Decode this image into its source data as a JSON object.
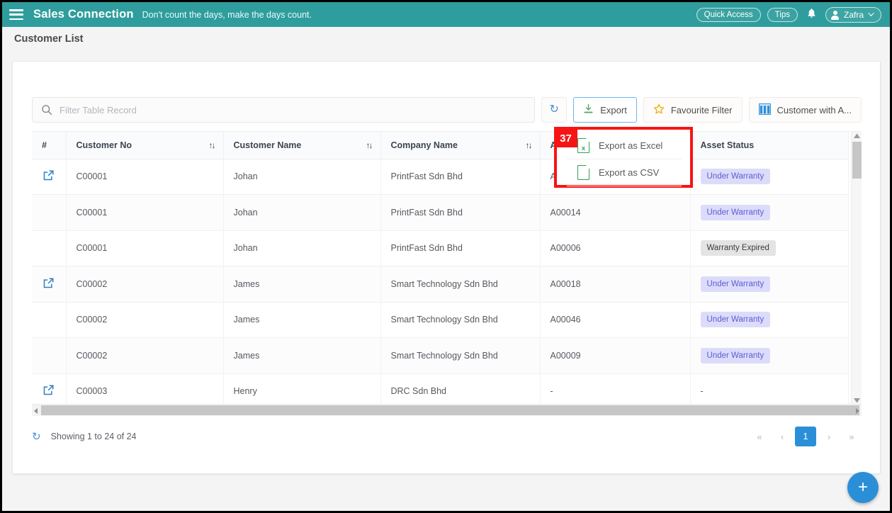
{
  "appbar": {
    "menu_icon": "hamburger-icon",
    "brand": "Sales Connection",
    "tagline": "Don't count the days, make the days count.",
    "quick_access": "Quick Access",
    "tips": "Tips",
    "bell_icon": "bell-icon",
    "user": "Zafra",
    "user_caret": "⌄",
    "teal": "#2f9d9d"
  },
  "page": {
    "title": "Customer List"
  },
  "toolbar": {
    "search_placeholder": "Filter Table Record",
    "search_value": "",
    "refresh_icon": "↻",
    "export_label": "Export",
    "favourite_filter_label": "Favourite Filter",
    "view_label": "Customer with A..."
  },
  "export_menu": {
    "annotation_number": "37",
    "items": [
      {
        "label": "Export as Excel",
        "icon_letter": "x"
      },
      {
        "label": "Export as CSV",
        "icon_letter": ""
      }
    ]
  },
  "table": {
    "columns": [
      {
        "label": "#",
        "sortable": false
      },
      {
        "label": "Customer No",
        "sortable": true
      },
      {
        "label": "Customer Name",
        "sortable": true
      },
      {
        "label": "Company Name",
        "sortable": true
      },
      {
        "label": "Asset No",
        "sortable": true
      },
      {
        "label": "Asset Status",
        "sortable": false
      }
    ],
    "sort_glyph": "↑↓",
    "rows": [
      {
        "open": true,
        "customer_no": "C00001",
        "customer_name": "Johan",
        "company_name": "PrintFast Sdn Bhd",
        "asset_no": "A00004",
        "asset_status": "Under Warranty",
        "status_type": "warranty"
      },
      {
        "open": false,
        "customer_no": "C00001",
        "customer_name": "Johan",
        "company_name": "PrintFast Sdn Bhd",
        "asset_no": "A00014",
        "asset_status": "Under Warranty",
        "status_type": "warranty"
      },
      {
        "open": false,
        "customer_no": "C00001",
        "customer_name": "Johan",
        "company_name": "PrintFast Sdn Bhd",
        "asset_no": "A00006",
        "asset_status": "Warranty Expired",
        "status_type": "expired"
      },
      {
        "open": true,
        "customer_no": "C00002",
        "customer_name": "James",
        "company_name": "Smart Technology Sdn Bhd",
        "asset_no": "A00018",
        "asset_status": "Under Warranty",
        "status_type": "warranty"
      },
      {
        "open": false,
        "customer_no": "C00002",
        "customer_name": "James",
        "company_name": "Smart Technology Sdn Bhd",
        "asset_no": "A00046",
        "asset_status": "Under Warranty",
        "status_type": "warranty"
      },
      {
        "open": false,
        "customer_no": "C00002",
        "customer_name": "James",
        "company_name": "Smart Technology Sdn Bhd",
        "asset_no": "A00009",
        "asset_status": "Under Warranty",
        "status_type": "warranty"
      },
      {
        "open": true,
        "customer_no": "C00003",
        "customer_name": "Henry",
        "company_name": "DRC Sdn Bhd",
        "asset_no": "-",
        "asset_status": "-",
        "status_type": "none"
      }
    ]
  },
  "footer": {
    "refresh_icon": "↻",
    "showing_text": "Showing 1 to 24 of 24",
    "pager": {
      "first": "«",
      "prev": "‹",
      "current": "1",
      "next": "›",
      "last": "»"
    }
  },
  "fab": {
    "label": "+"
  }
}
